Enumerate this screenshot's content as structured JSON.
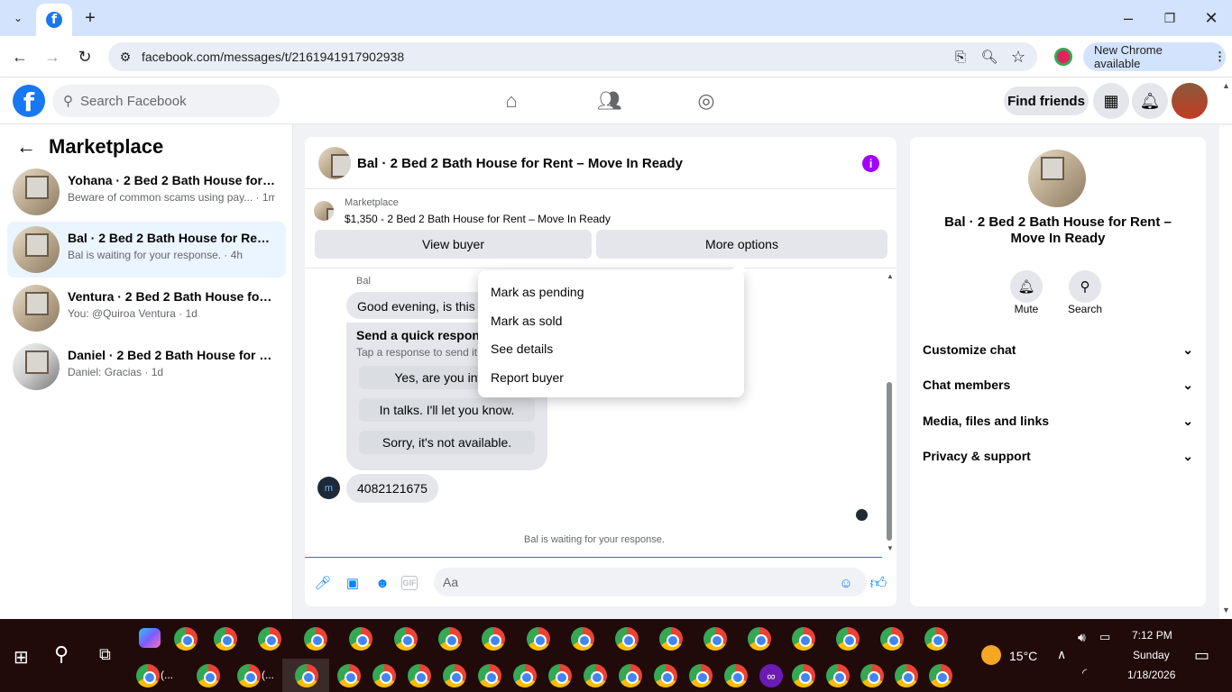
{
  "browser": {
    "url": "facebook.com/messages/t/2161941917902938",
    "new_chrome": "New Chrome available"
  },
  "header": {
    "search_placeholder": "Search Facebook",
    "find_friends": "Find friends"
  },
  "sidebar": {
    "title": "Marketplace",
    "conversations": [
      {
        "name": "Yohana · 2 Bed 2 Bath House for R...",
        "sub": "Beware of common scams using pay... · 1m"
      },
      {
        "name": "Bal · 2 Bed 2 Bath House for Rent ...",
        "sub": "Bal is waiting for your response. · 4h"
      },
      {
        "name": "Ventura · 2 Bed 2 Bath House for R...",
        "sub": "You: @Quiroa Ventura · 1d"
      },
      {
        "name": "Daniel · 2 Bed 2 Bath House for Re...",
        "sub": "Daniel: Gracias · 1d"
      }
    ]
  },
  "chat": {
    "title": "Bal · 2 Bed 2 Bath House for Rent – Move In Ready",
    "marketplace_label": "Marketplace",
    "listing": "$1,350 - 2 Bed 2 Bath House for Rent – Move In Ready",
    "view_buyer": "View buyer",
    "more_options": "More options",
    "sender": "Bal",
    "first_message": "Good evening, is this s",
    "quick_title": "Send a quick response",
    "quick_sub": "Tap a response to send it t",
    "quick_responses": [
      "Yes, are you intere",
      "In talks. I'll let you know.",
      "Sorry, it's not available."
    ],
    "phone_message": "4082121675",
    "waiting": "Bal is waiting for your response.",
    "composer_placeholder": "Aa"
  },
  "menu": {
    "items": [
      "Mark as pending",
      "Mark as sold",
      "See details",
      "Report buyer"
    ]
  },
  "right_panel": {
    "title": "Bal · 2 Bed 2 Bath House for Rent – Move In Ready",
    "mute": "Mute",
    "search": "Search",
    "sections": [
      "Customize chat",
      "Chat members",
      "Media, files and links",
      "Privacy & support"
    ]
  },
  "taskbar": {
    "temperature": "15°C",
    "time": "7:12 PM",
    "day": "Sunday",
    "date": "1/18/2026",
    "label_a": "(...",
    "label_b": "(..."
  },
  "colors": {
    "fb_blue": "#1877f2",
    "accent_purple": "#a100ff",
    "messenger_blue": "#0084ff"
  }
}
